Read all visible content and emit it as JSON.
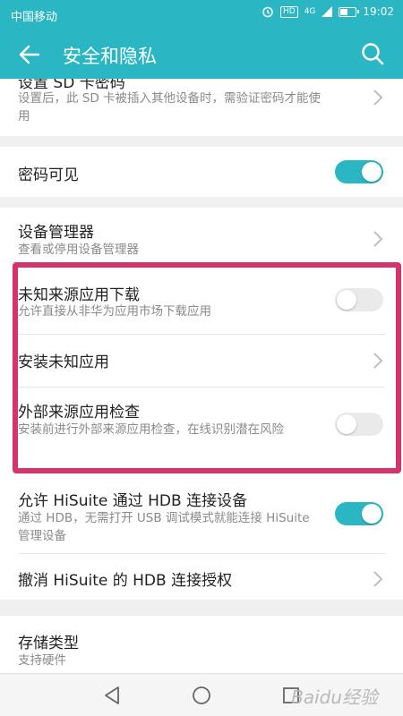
{
  "status_bar": {
    "carrier": "中国移动",
    "network_label": "HD",
    "network_type": "4G",
    "time": "19:02",
    "battery_level": 0.4
  },
  "app_bar": {
    "title": "安全和隐私",
    "back_icon": "arrow-left-icon",
    "search_icon": "search-icon"
  },
  "settings": {
    "sd_card_password": {
      "title": "设置 SD 卡密码",
      "subtitle": "设置后，此 SD 卡被插入其他设备时，需验证密码才能使用"
    },
    "password_visible": {
      "title": "密码可见",
      "enabled": true
    },
    "device_manager": {
      "title": "设备管理器",
      "subtitle": "查看或停用设备管理器"
    },
    "unknown_sources": {
      "title": "未知来源应用下载",
      "subtitle": "允许直接从非华为应用市场下载应用",
      "enabled": false
    },
    "install_unknown_apps": {
      "title": "安装未知应用"
    },
    "external_app_check": {
      "title": "外部来源应用检查",
      "subtitle": "安装前进行外部来源应用检查，在线识别潜在风险",
      "enabled": false
    },
    "hisuite_hdb": {
      "title": "允许 HiSuite 通过 HDB 连接设备",
      "subtitle": "通过 HDB，无需打开 USB 调试模式就能连接 HiSuite 管理设备",
      "enabled": true
    },
    "revoke_hisuite": {
      "title": "撤消 HiSuite 的 HDB 连接授权"
    },
    "storage_type": {
      "title": "存储类型",
      "subtitle": "支持硬件"
    }
  },
  "colors": {
    "accent": "#2bb6c4",
    "highlight_border": "#d6336c"
  },
  "nav_bar": {
    "back": "triangle-back-icon",
    "home": "circle-home-icon",
    "recents": "square-recents-icon"
  },
  "watermark": "Baidu经验"
}
